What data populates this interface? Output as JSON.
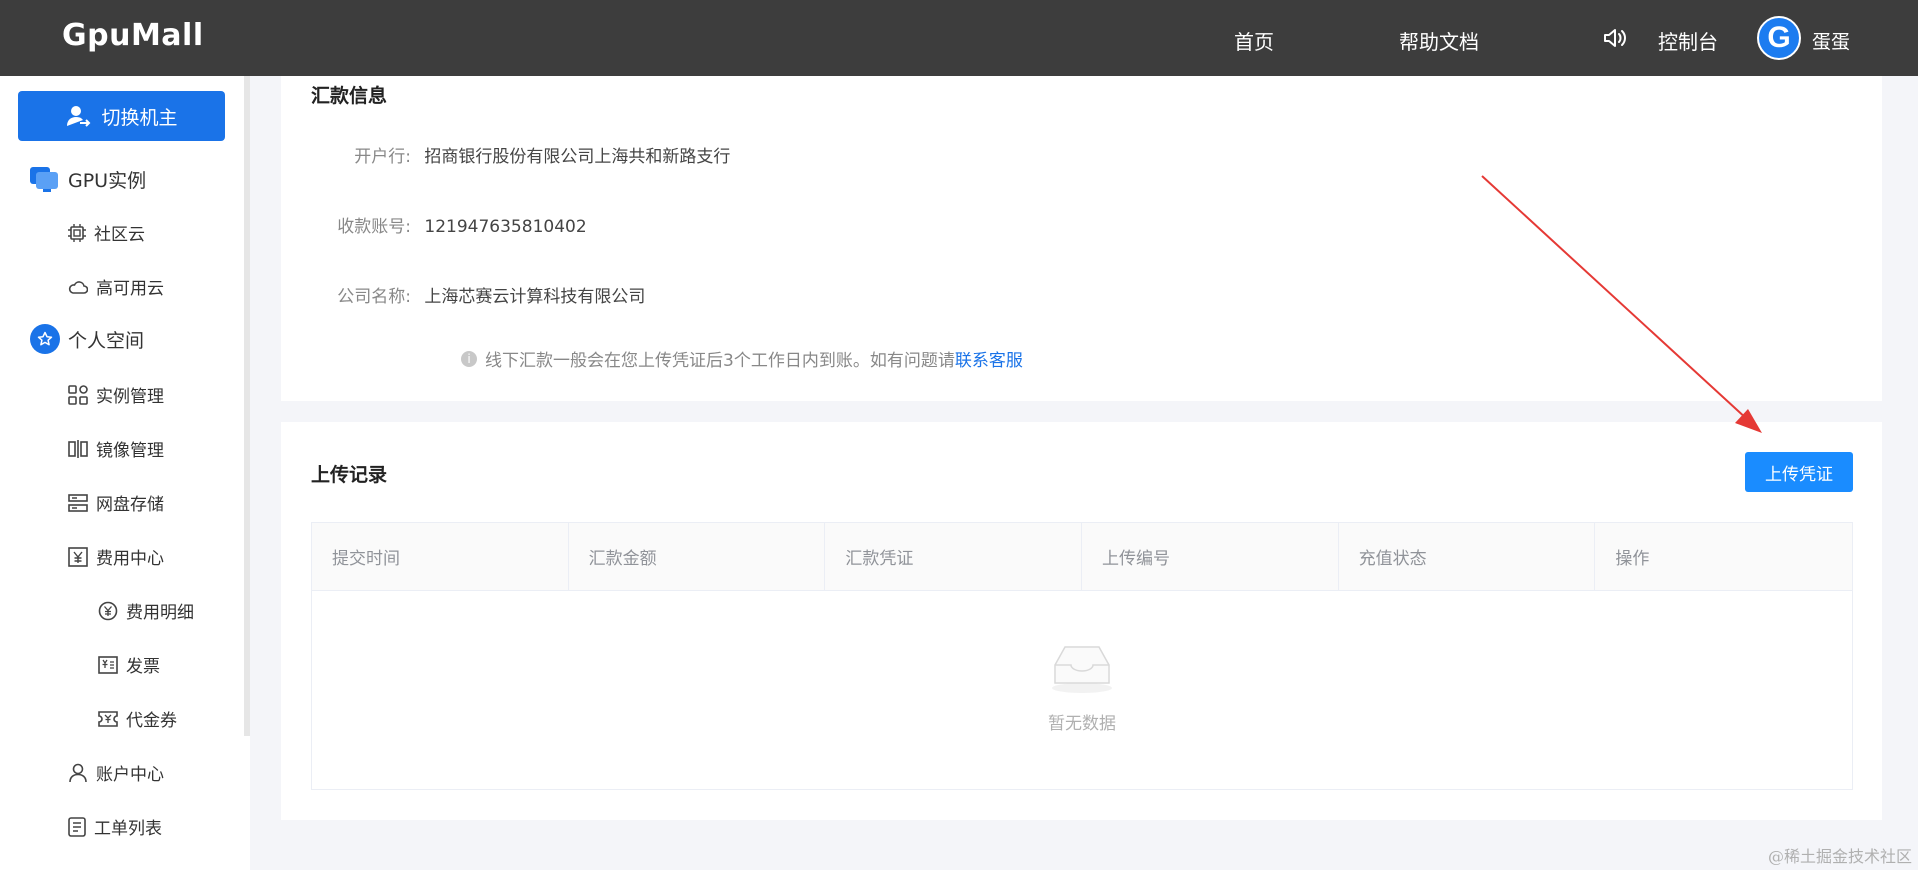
{
  "header": {
    "logo": "GpuMall",
    "nav_home": "首页",
    "nav_docs": "帮助文档",
    "nav_console": "控制台",
    "avatar_letter": "G",
    "username": "蛋蛋"
  },
  "sidebar": {
    "switch_label": "切换机主",
    "gpu_instances": "GPU实例",
    "community_cloud": "社区云",
    "ha_cloud": "高可用云",
    "personal_space": "个人空间",
    "instance_mgmt": "实例管理",
    "image_mgmt": "镜像管理",
    "disk_storage": "网盘存储",
    "billing_center": "费用中心",
    "billing_details": "费用明细",
    "invoice": "发票",
    "voucher": "代金券",
    "account_center": "账户中心",
    "ticket_list": "工单列表"
  },
  "remit": {
    "title": "汇款信息",
    "bank_label": "开户行:",
    "bank_value": "招商银行股份有限公司上海共和新路支行",
    "account_label": "收款账号:",
    "account_value": "121947635810402",
    "company_label": "公司名称:",
    "company_value": "上海芯赛云计算科技有限公司",
    "notice_text": "线下汇款一般会在您上传凭证后3个工作日内到账。如有问题请",
    "notice_link": "联系客服"
  },
  "records": {
    "title": "上传记录",
    "upload_button": "上传凭证",
    "columns": [
      "提交时间",
      "汇款金额",
      "汇款凭证",
      "上传编号",
      "充值状态",
      "操作"
    ],
    "empty_text": "暂无数据"
  },
  "watermark": "@稀土掘金技术社区",
  "colors": {
    "header_bg": "#3d3d3d",
    "primary": "#1a73e8",
    "upload_button": "#1a8cff",
    "arrow": "#e53935"
  }
}
